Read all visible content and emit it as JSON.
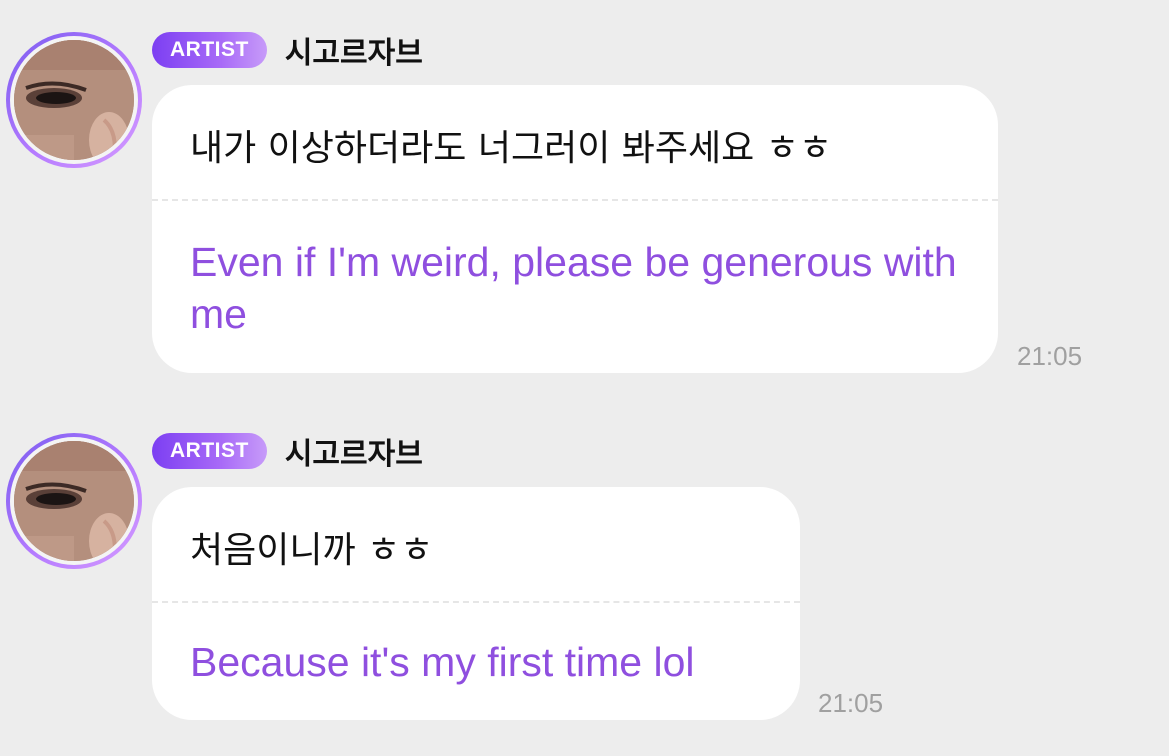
{
  "messages": [
    {
      "badge": "ARTIST",
      "sender": "시고르자브",
      "text_original": "내가 이상하더라도 너그러이 봐주세요 ㅎㅎ",
      "text_translated": "Even if I'm weird, please be generous with me",
      "time": "21:05"
    },
    {
      "badge": "ARTIST",
      "sender": "시고르자브",
      "text_original": "처음이니까 ㅎㅎ",
      "text_translated": "Because it's my first time lol",
      "time": "21:05"
    }
  ]
}
